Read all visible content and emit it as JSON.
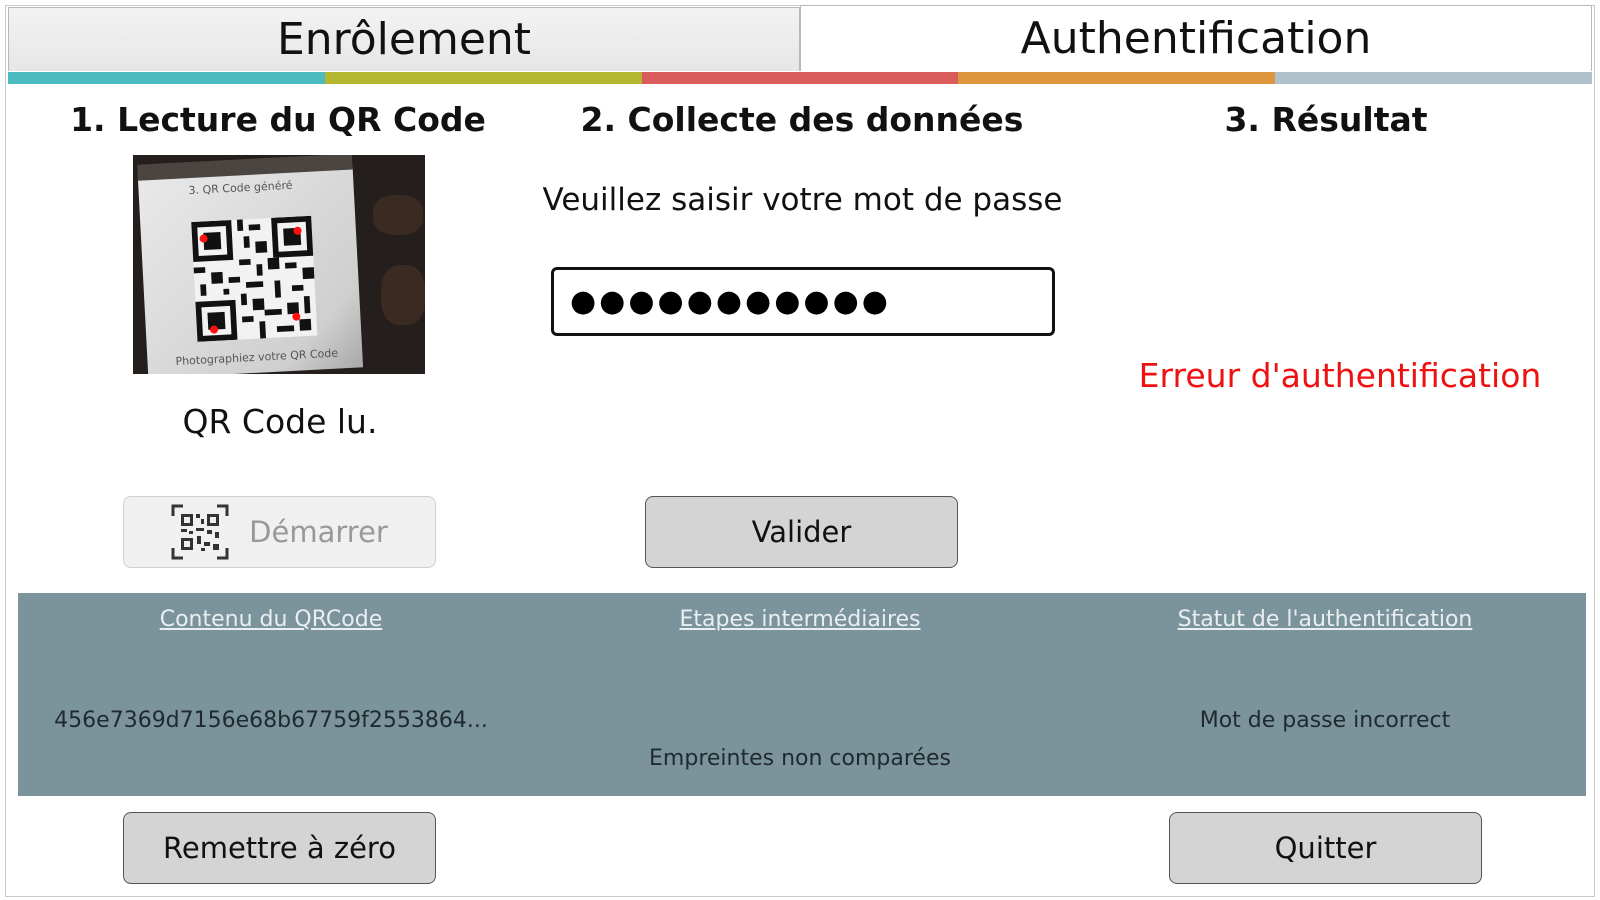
{
  "tabs": {
    "enrolment": "Enrôlement",
    "authentication": "Authentification"
  },
  "accent_colors": [
    "#4bbcbf",
    "#b4b62d",
    "#d85c5c",
    "#e0953f",
    "#afc1cb"
  ],
  "steps": {
    "step1": "1. Lecture du QR Code",
    "step2": "2. Collecte des données",
    "step3": "3. Résultat"
  },
  "qr_preview": {
    "caption_top": "3. QR Code généré",
    "caption_bottom": "Photographiez votre QR Code"
  },
  "qr_status": "QR Code lu.",
  "start_button": "Démarrer",
  "password_prompt": "Veuillez saisir votre mot de passe",
  "password_value": "●●●●●●●●●●●",
  "validate_button": "Valider",
  "auth_result": "Erreur d'authentification",
  "info": {
    "qr_header": "Contenu du QRCode",
    "steps_header": "Etapes intermédiaires",
    "status_header": "Statut de l'authentification",
    "qr_content": "456e7369d7156e68b67759f2553864...",
    "steps_content": "Empreintes non comparées",
    "status_content": "Mot de passe incorrect"
  },
  "reset_button": "Remettre à zéro",
  "quit_button": "Quitter"
}
